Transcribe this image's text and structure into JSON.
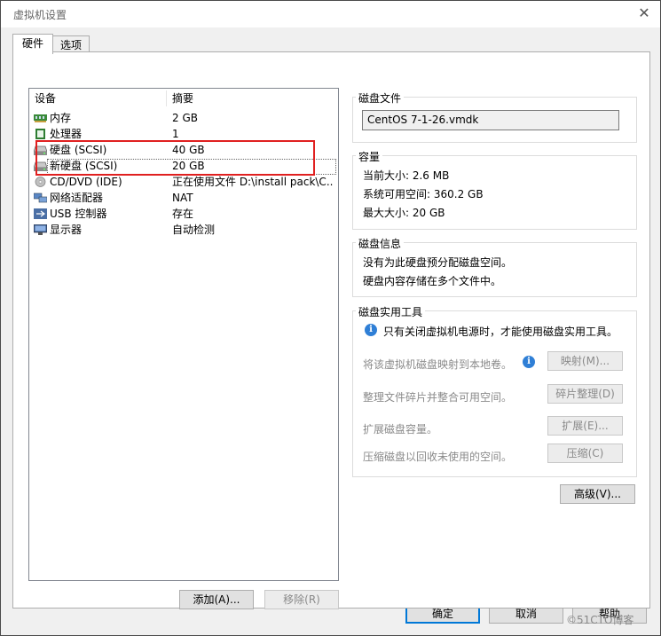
{
  "window": {
    "title": "虚拟机设置",
    "close_glyph": "✕"
  },
  "tabs": [
    {
      "label": "硬件"
    },
    {
      "label": "选项"
    }
  ],
  "device_list": {
    "headers": {
      "device": "设备",
      "summary": "摘要"
    },
    "rows": [
      {
        "name": "内存",
        "summary": "2 GB",
        "icon": "memory-icon"
      },
      {
        "name": "处理器",
        "summary": "1",
        "icon": "processor-icon"
      },
      {
        "name": "硬盘 (SCSI)",
        "summary": "40 GB",
        "icon": "hard-disk-icon"
      },
      {
        "name": "新硬盘 (SCSI)",
        "summary": "20 GB",
        "icon": "hard-disk-icon"
      },
      {
        "name": "CD/DVD (IDE)",
        "summary": "正在使用文件 D:\\install pack\\C...",
        "icon": "cd-dvd-icon"
      },
      {
        "name": "网络适配器",
        "summary": "NAT",
        "icon": "network-adapter-icon"
      },
      {
        "name": "USB 控制器",
        "summary": "存在",
        "icon": "usb-icon"
      },
      {
        "name": "显示器",
        "summary": "自动检测",
        "icon": "display-icon"
      }
    ],
    "selected_index": 3,
    "highlight_color": "#e02020"
  },
  "list_buttons": {
    "add": "添加(A)...",
    "remove": "移除(R)"
  },
  "disk_file": {
    "title": "磁盘文件",
    "value": "CentOS 7-1-26.vmdk"
  },
  "capacity": {
    "title": "容量",
    "current_size": "当前大小: 2.6 MB",
    "system_free": "系统可用空间: 360.2 GB",
    "max_size": "最大大小: 20 GB"
  },
  "disk_info": {
    "title": "磁盘信息",
    "line1": "没有为此硬盘预分配磁盘空间。",
    "line2": "硬盘内容存储在多个文件中。"
  },
  "disk_utilities": {
    "title": "磁盘实用工具",
    "note": "只有关闭虚拟机电源时，才能使用磁盘实用工具。",
    "map_text": "将该虚拟机磁盘映射到本地卷。",
    "map_button": "映射(M)...",
    "defrag_text": "整理文件碎片并整合可用空间。",
    "defrag_button": "碎片整理(D)",
    "expand_text": "扩展磁盘容量。",
    "expand_button": "扩展(E)...",
    "compact_text": "压缩磁盘以回收未使用的空间。",
    "compact_button": "压缩(C)"
  },
  "advanced_button": "高级(V)...",
  "dialog_buttons": {
    "ok": "确定",
    "cancel": "取消",
    "help": "帮助"
  },
  "watermark": "©51CTO博客"
}
